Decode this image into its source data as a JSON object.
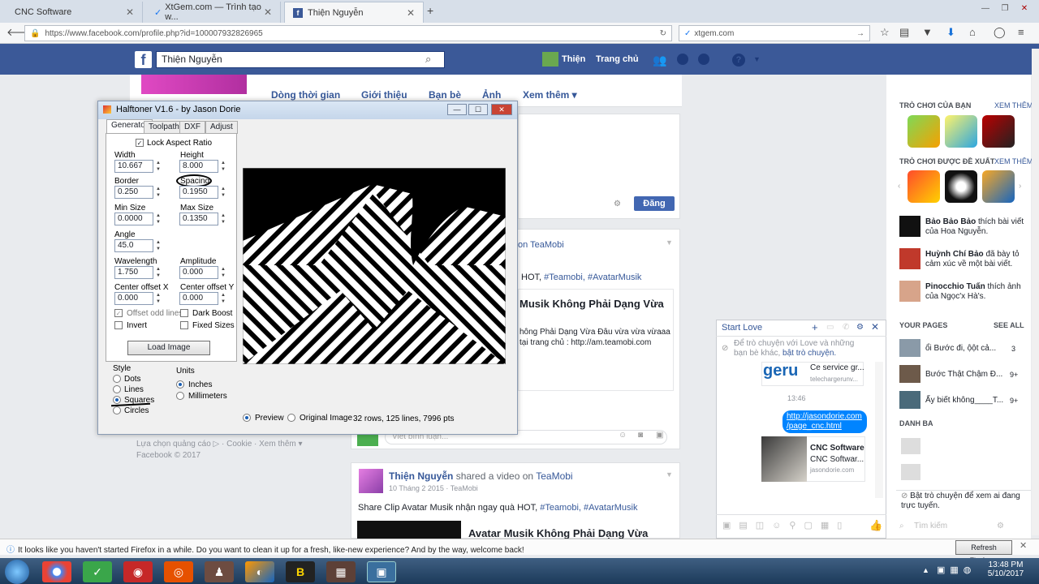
{
  "browser": {
    "tabs": [
      {
        "label": "CNC Software"
      },
      {
        "label": "XtGem.com — Trình tạo w..."
      },
      {
        "label": "Thiện Nguyễn"
      }
    ],
    "url": "https://www.facebook.com/profile.php?id=100007932826965",
    "search_value": "xtgem.com"
  },
  "fb": {
    "search_value": "Thiện Nguyễn",
    "nav_user": "Thiện",
    "nav_home": "Trang chủ",
    "profile_tabs": [
      "Dòng thời gian",
      "Giới thiệu",
      "Bạn bè",
      "Ảnh",
      "Xem thêm ▾"
    ],
    "post_button": "Đăng",
    "post1": {
      "page": "on TeaMobi",
      "share": "HOT,",
      "tags": [
        "#Teamobi,",
        "#AvatarMusik"
      ],
      "title": "Musik Không Phải Dạng Vừa",
      "desc1": "hông Phải Dạng Vừa Đâu vừa vừa vừaaa",
      "desc2": "tại trang chủ : http://am.teamobi.com",
      "comment_placeholder": "Viết bình luận..."
    },
    "post2": {
      "author": "Thiện Nguyễn",
      "action": "shared a video on",
      "page": "TeaMobi",
      "date": "10 Tháng 2 2015 · TeaMobi",
      "text": "Share Clip Avatar Musik nhận ngay quà HOT,",
      "tags": [
        "#Teamobi,",
        "#AvatarMusik"
      ],
      "title": "Avatar Musik Không Phải Dạng Vừa"
    },
    "footer": {
      "line1": "Lựa chọn quảng cáo ▷ · Cookie · Xem thêm ▾",
      "line2": "Facebook © 2017"
    }
  },
  "sidebar": {
    "games_head": "TRÒ CHƠI CỦA BẠN",
    "see_all": "XEM THÊM",
    "suggest_head": "TRÒ CHƠI ĐƯỢC ĐỀ XUẤT",
    "feed": [
      {
        "name": "Bảo Bảo Bảo",
        "text": "thích bài viết của Hoa Nguyễn."
      },
      {
        "name": "Huỳnh Chí Bảo",
        "text": "đã bày tỏ cảm xúc về một bài viết."
      },
      {
        "name": "Pinocchio Tuấn",
        "text": "thích ảnh của Ngọc'x Hà's."
      }
    ],
    "pages_head": "YOUR PAGES",
    "pages_all": "SEE ALL",
    "pages": [
      {
        "name": "ổi Bước đi, ộột cả...",
        "count": "3"
      },
      {
        "name": "Bước Thật Chậm Đ...",
        "count": "9+"
      },
      {
        "name": "Ấy biết không____T...",
        "count": "9+"
      }
    ],
    "list_head": "DANH BA",
    "chat_hint": "Bật trò chuyện để xem ai đang trực tuyến.",
    "chat_search": "Tìm kiếm"
  },
  "chat": {
    "title": "Start Love",
    "notice1": "Để trò chuyện với Love và những bạn bè khác,",
    "notice_link": "bật trò chuyện.",
    "preview_text": "Ce service gr...",
    "preview_site": "telechargerunv...",
    "time": "13:46",
    "link_msg": "http://jasondorie.com /page_cnc.html",
    "card_title": "CNC Software",
    "card_sub": "CNC Softwar...",
    "card_site": "jasondorie.com"
  },
  "halftoner": {
    "title": "Halftoner V1.6 - by Jason Dorie",
    "tabs": [
      "Generator",
      "Toolpath",
      "DXF",
      "Adjust"
    ],
    "lock_aspect": "Lock Aspect Ratio",
    "width_label": "Width",
    "width": "10.667",
    "height_label": "Height",
    "height": "8.000",
    "border_label": "Border",
    "border": "0.250",
    "spacing_label": "Spacing",
    "spacing": "0.1950",
    "minsize_label": "Min Size",
    "minsize": "0.0000",
    "maxsize_label": "Max Size",
    "maxsize": "0.1350",
    "angle_label": "Angle",
    "angle": "45.0",
    "wavelength_label": "Wavelength",
    "wavelength": "1.750",
    "amplitude_label": "Amplitude",
    "amplitude": "0.000",
    "cx_label": "Center offset X",
    "cx": "0.000",
    "cy_label": "Center offset Y",
    "cy": "0.000",
    "offset_odd": "Offset odd lines",
    "dark_boost": "Dark Boost",
    "invert": "Invert",
    "fixed_sizes": "Fixed Sizes",
    "load_image": "Load Image",
    "style_label": "Style",
    "styles": [
      "Dots",
      "Lines",
      "Squares",
      "Circles"
    ],
    "units_label": "Units",
    "units": [
      "Inches",
      "Millimeters"
    ],
    "preview": "Preview",
    "original": "Original Image",
    "stats": "32 rows, 125 lines, 7996 pts"
  },
  "firefox_msg": "It looks like you haven't started Firefox in a while. Do you want to clean it up for a fresh, like-new experience? And by the way, welcome back!",
  "refresh_btn": "Refresh Firefox...",
  "clock": {
    "time": "13:48 PM",
    "date": "5/10/2017"
  }
}
